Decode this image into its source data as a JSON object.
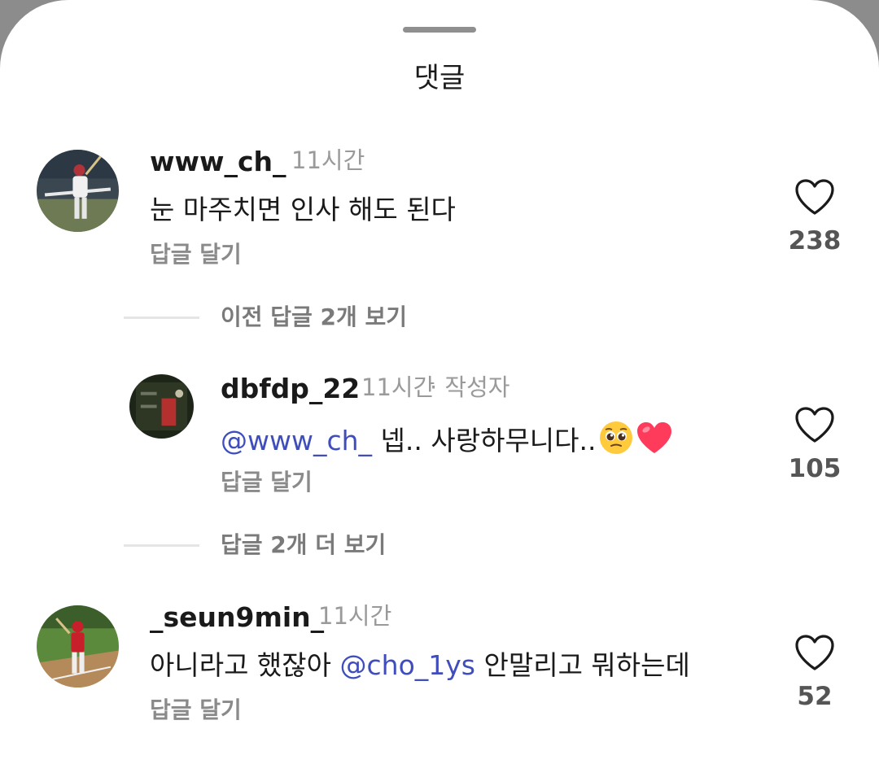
{
  "sheet": {
    "title": "댓글"
  },
  "comments": [
    {
      "username": "www_ch_",
      "time": "11시간",
      "text": "눈 마주치면 인사 해도 된다",
      "reply_label": "답글 달기",
      "likes": "238"
    },
    {
      "username": "dbfdp_22",
      "time": "11시간",
      "author_badge": "· 작성자",
      "mention": "@www_ch_",
      "text": "넵.. 사랑하무니다..",
      "emojis": [
        "pleading-face-emoji",
        "red-heart-emoji"
      ],
      "reply_label": "답글 달기",
      "likes": "105"
    },
    {
      "username": "_seun9min_",
      "time": "11시간",
      "text_before": "아니라고 했잖아",
      "mention": "@cho_1ys",
      "text_after": "안말리고 뭐하는데",
      "reply_label": "답글 달기",
      "likes": "52"
    }
  ],
  "threads": {
    "view_previous": "이전 답글 2개 보기",
    "view_more": "답글 2개 더 보기"
  },
  "colors": {
    "mention": "#3f4dbd",
    "muted": "#8a8a8a",
    "heart_emoji": "#ff3b5c"
  }
}
